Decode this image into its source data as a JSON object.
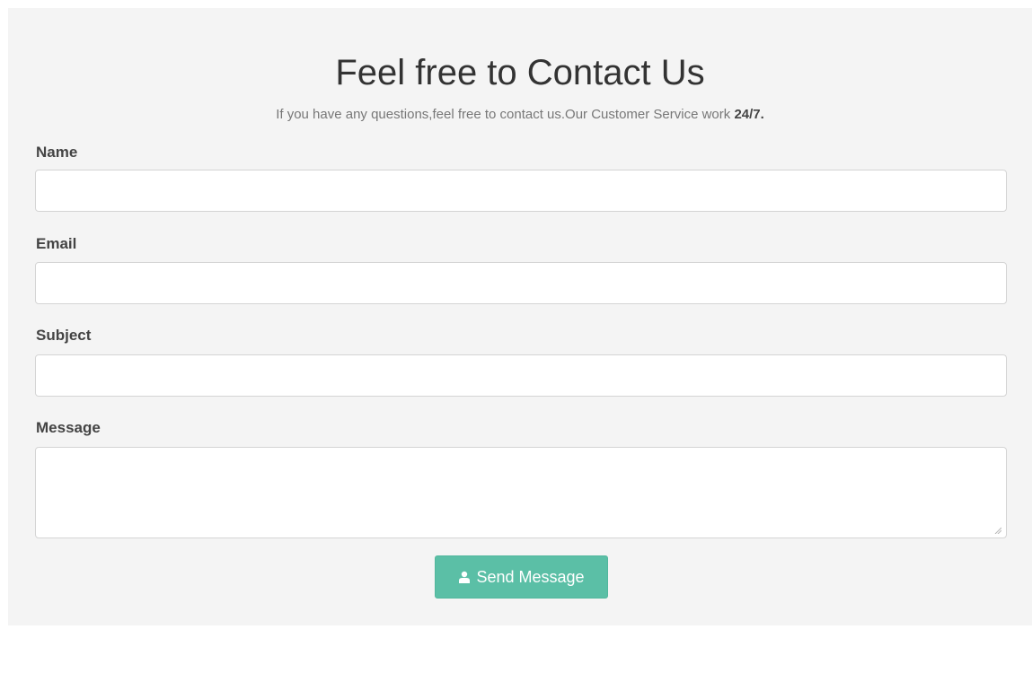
{
  "form": {
    "title": "Feel free to Contact Us",
    "subtitle_text": "If you have any questions,feel free to contact us.Our Customer Service work ",
    "subtitle_strong": "24/7.",
    "fields": {
      "name": {
        "label": "Name",
        "value": ""
      },
      "email": {
        "label": "Email",
        "value": ""
      },
      "subject": {
        "label": "Subject",
        "value": ""
      },
      "message": {
        "label": "Message",
        "value": ""
      }
    },
    "submit": {
      "label": "Send Message",
      "icon": "user-icon",
      "color": "#5bbfa6"
    }
  }
}
